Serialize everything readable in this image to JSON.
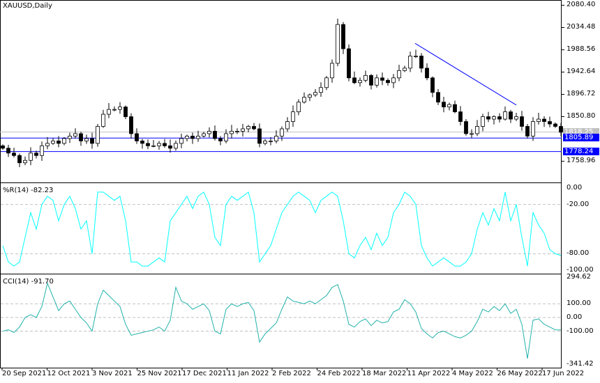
{
  "chart": {
    "symbol_label": "XAUUSD,Daily",
    "price_axis": [
      "2080.40",
      "2034.48",
      "1988.56",
      "1942.64",
      "1896.72",
      "1850.80",
      "1758.96"
    ],
    "price_range": [
      1758.96,
      2080.4
    ],
    "current_price": "1818.25",
    "levels": [
      {
        "value": "1805.89",
        "color": "#0000ff"
      },
      {
        "value": "1778.24",
        "color": "#0000ff"
      }
    ],
    "trendline": {
      "from": 2001,
      "to": 1874,
      "color": "#0000ff"
    },
    "closes": [
      1785,
      1775,
      1770,
      1755,
      1760,
      1775,
      1770,
      1790,
      1795,
      1800,
      1795,
      1805,
      1810,
      1815,
      1800,
      1805,
      1795,
      1830,
      1855,
      1865,
      1865,
      1870,
      1850,
      1815,
      1800,
      1795,
      1790,
      1790,
      1795,
      1790,
      1785,
      1795,
      1805,
      1810,
      1805,
      1810,
      1815,
      1820,
      1805,
      1800,
      1815,
      1820,
      1820,
      1825,
      1830,
      1825,
      1795,
      1800,
      1800,
      1810,
      1825,
      1840,
      1860,
      1880,
      1890,
      1895,
      1900,
      1910,
      1930,
      1960,
      2040,
      1990,
      1930,
      1920,
      1925,
      1935,
      1915,
      1930,
      1925,
      1920,
      1930,
      1945,
      1950,
      1975,
      1975,
      1950,
      1930,
      1900,
      1880,
      1870,
      1875,
      1860,
      1840,
      1815,
      1815,
      1830,
      1850,
      1845,
      1850,
      1845,
      1860,
      1845,
      1850,
      1830,
      1810,
      1840,
      1845,
      1840,
      1835,
      1830,
      1818
    ]
  },
  "wr": {
    "label": "%R(14) -82.23",
    "axis": [
      "0.00",
      "-20.00",
      "-80.00",
      "-100.00"
    ],
    "color": "#00ffff",
    "values": [
      -70,
      -90,
      -95,
      -90,
      -60,
      -30,
      -50,
      -20,
      -10,
      -15,
      -40,
      -20,
      -10,
      -25,
      -50,
      -40,
      -80,
      -5,
      -5,
      -10,
      -15,
      -10,
      -40,
      -90,
      -90,
      -95,
      -95,
      -90,
      -85,
      -90,
      -40,
      -30,
      -20,
      -10,
      -25,
      -10,
      -5,
      -20,
      -60,
      -70,
      -20,
      -10,
      -15,
      -10,
      -5,
      -30,
      -90,
      -80,
      -70,
      -50,
      -30,
      -20,
      -10,
      -5,
      -10,
      -15,
      -30,
      -15,
      -10,
      -5,
      -10,
      -40,
      -80,
      -85,
      -70,
      -60,
      -75,
      -55,
      -70,
      -60,
      -30,
      -20,
      -5,
      -10,
      -20,
      -70,
      -85,
      -95,
      -90,
      -85,
      -90,
      -95,
      -95,
      -90,
      -80,
      -50,
      -30,
      -45,
      -25,
      -40,
      -5,
      -40,
      -20,
      -60,
      -95,
      -30,
      -45,
      -55,
      -75,
      -80,
      -82.23
    ]
  },
  "cci": {
    "label": "CCI(14) -91.70",
    "axis": [
      "294.62",
      "100.00",
      "0.00",
      "-100.00",
      "-341.42"
    ],
    "color": "#20b2aa",
    "values": [
      -100,
      -90,
      -110,
      -70,
      0,
      20,
      0,
      80,
      250,
      150,
      50,
      100,
      120,
      60,
      0,
      -40,
      -100,
      100,
      200,
      160,
      120,
      80,
      -50,
      -130,
      -120,
      -110,
      -100,
      -90,
      -70,
      -100,
      -20,
      220,
      120,
      100,
      60,
      80,
      100,
      50,
      -100,
      -120,
      60,
      100,
      80,
      100,
      110,
      50,
      -180,
      -120,
      -80,
      -40,
      60,
      150,
      120,
      110,
      100,
      120,
      100,
      130,
      160,
      220,
      240,
      120,
      -50,
      -70,
      -30,
      -10,
      -60,
      -20,
      -40,
      -30,
      40,
      60,
      130,
      100,
      40,
      -80,
      -120,
      -150,
      -110,
      -100,
      -120,
      -140,
      -150,
      -130,
      -100,
      -30,
      60,
      40,
      80,
      50,
      100,
      30,
      60,
      -50,
      -300,
      -20,
      -10,
      -50,
      -70,
      -90,
      -91.7
    ]
  },
  "dates": [
    "20 Sep 2021",
    "12 Oct 2021",
    "3 Nov 2021",
    "25 Nov 2021",
    "17 Dec 2021",
    "11 Jan 2022",
    "2 Feb 2022",
    "24 Feb 2022",
    "18 Mar 2022",
    "11 Apr 2022",
    "4 May 2022",
    "26 May 2022",
    "17 Jun 2022"
  ]
}
